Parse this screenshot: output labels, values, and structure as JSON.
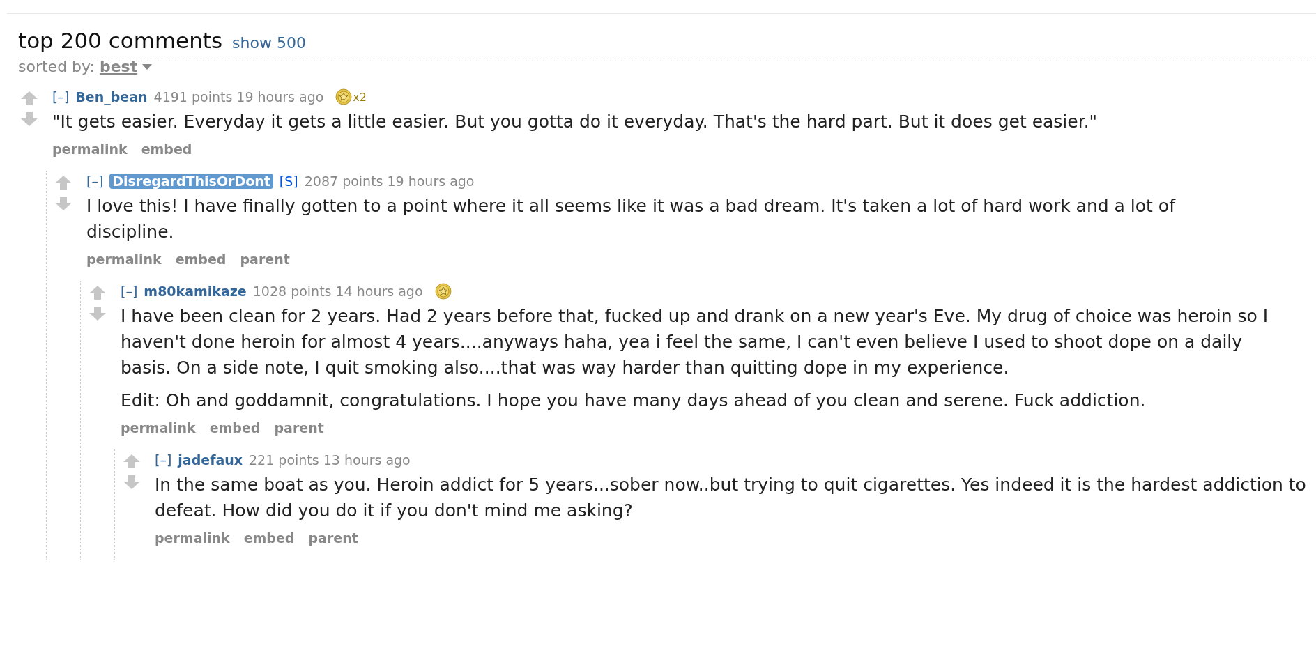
{
  "header": {
    "title": "top 200 comments",
    "show_more": "show 500"
  },
  "sort": {
    "label": "sorted by:",
    "value": "best"
  },
  "comments": [
    {
      "toggle": "[–]",
      "author": "Ben_bean",
      "submitter": false,
      "points": "4191 points",
      "time": "19 hours ago",
      "gilded": true,
      "gild_count": "x2",
      "paragraphs": [
        "\"It gets easier. Everyday it gets a little easier. But you gotta do it everyday. That's the hard part. But it does get easier.\""
      ],
      "buttons": [
        "permalink",
        "embed"
      ],
      "children": [
        {
          "toggle": "[–]",
          "author": "DisregardThisOrDont",
          "submitter": true,
          "submitter_tag": "[S]",
          "points": "2087 points",
          "time": "19 hours ago",
          "gilded": false,
          "paragraphs": [
            "I love this! I have finally gotten to a point where it all seems like it was a bad dream. It's taken a lot of hard work and a lot of discipline."
          ],
          "buttons": [
            "permalink",
            "embed",
            "parent"
          ],
          "children": [
            {
              "toggle": "[–]",
              "author": "m80kamikaze",
              "submitter": false,
              "points": "1028 points",
              "time": "14 hours ago",
              "gilded": true,
              "paragraphs": [
                "I have been clean for 2 years. Had 2 years before that, fucked up and drank on a new year's Eve. My drug of choice was heroin so I haven't done heroin for almost 4 years....anyways haha, yea i feel the same, I can't even believe I used to shoot dope on a daily basis. On a side note, I quit smoking also....that was way harder than quitting dope in my experience.",
                "Edit: Oh and goddamnit, congratulations. I hope you have many days ahead of you clean and serene. Fuck addiction."
              ],
              "buttons": [
                "permalink",
                "embed",
                "parent"
              ],
              "children": [
                {
                  "toggle": "[–]",
                  "author": "jadefaux",
                  "submitter": false,
                  "points": "221 points",
                  "time": "13 hours ago",
                  "gilded": false,
                  "paragraphs": [
                    "In the same boat as you. Heroin addict for 5 years...sober now..but trying to quit cigarettes. Yes indeed it is the hardest addiction to defeat. How did you do it if you don't mind me asking?"
                  ],
                  "buttons": [
                    "permalink",
                    "embed",
                    "parent"
                  ]
                }
              ]
            }
          ]
        }
      ]
    }
  ]
}
